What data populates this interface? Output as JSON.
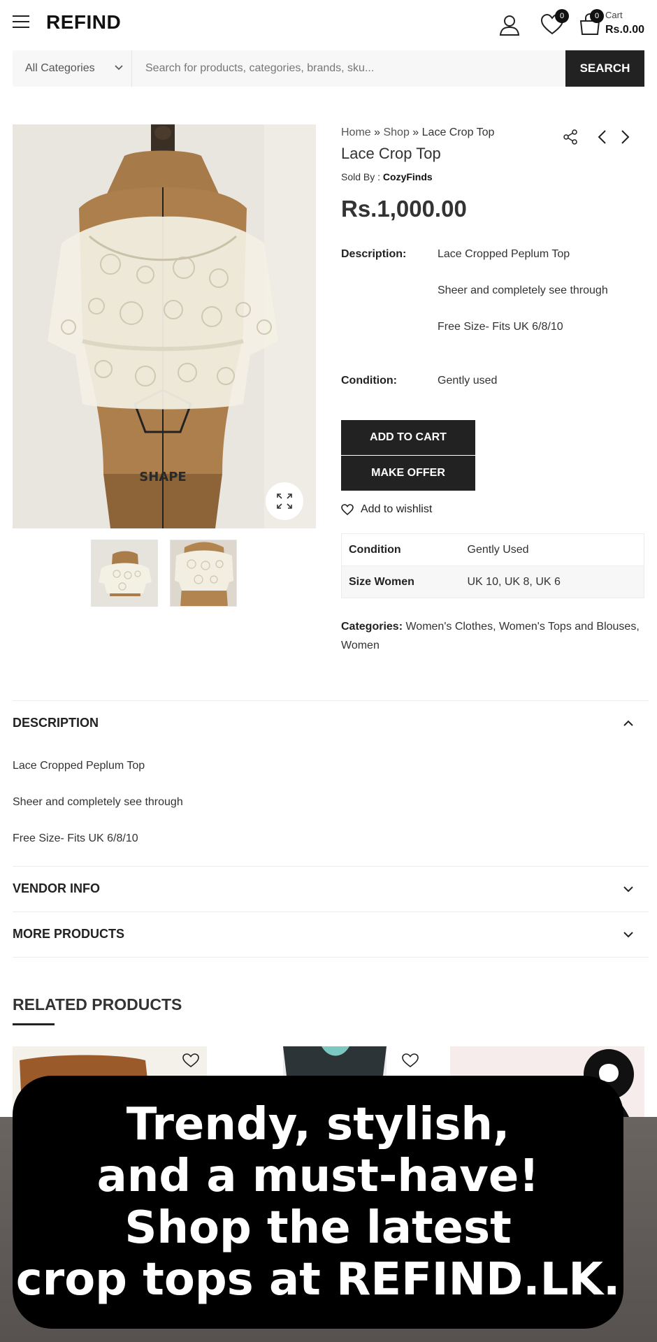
{
  "header": {
    "logo": "REFIND",
    "wishlist_count": "0",
    "cart_count": "0",
    "cart_label": "Cart",
    "cart_total": "Rs.0.00"
  },
  "search": {
    "category": "All Categories",
    "placeholder": "Search for products, categories, brands, sku...",
    "button": "SEARCH"
  },
  "breadcrumb": {
    "home": "Home",
    "sep": " » ",
    "shop": "Shop",
    "current": "Lace Crop Top"
  },
  "product": {
    "title": "Lace Crop Top",
    "sold_by_label": "Sold By : ",
    "vendor": "CozyFinds",
    "price": "Rs.1,000.00",
    "description_label": "Description:",
    "description_lines": [
      "Lace Cropped Peplum Top",
      "Sheer and completely see through",
      "Free Size- Fits UK 6/8/10"
    ],
    "condition_label": "Condition:",
    "condition_value": "Gently used",
    "add_to_cart": "ADD TO CART",
    "make_offer": "MAKE OFFER",
    "add_to_wishlist": "Add to wishlist",
    "attributes": [
      {
        "key": "Condition",
        "value": "Gently Used"
      },
      {
        "key": "Size Women",
        "value": "UK 10, UK 8, UK 6"
      }
    ],
    "categories_label": "Categories:",
    "categories": [
      "Women's Clothes",
      "Women's Tops and Blouses",
      "Women"
    ]
  },
  "accordions": {
    "description_title": "DESCRIPTION",
    "description_lines": [
      "Lace Cropped Peplum Top",
      "Sheer and completely see through",
      "Free Size- Fits UK 6/8/10"
    ],
    "vendor_title": "VENDOR INFO",
    "more_title": "MORE PRODUCTS"
  },
  "related": {
    "title": "RELATED PRODUCTS"
  },
  "overlay": {
    "lines": [
      "Trendy, stylish,",
      "and a must-have!",
      "Shop the latest",
      "crop tops at REFIND.LK."
    ]
  }
}
